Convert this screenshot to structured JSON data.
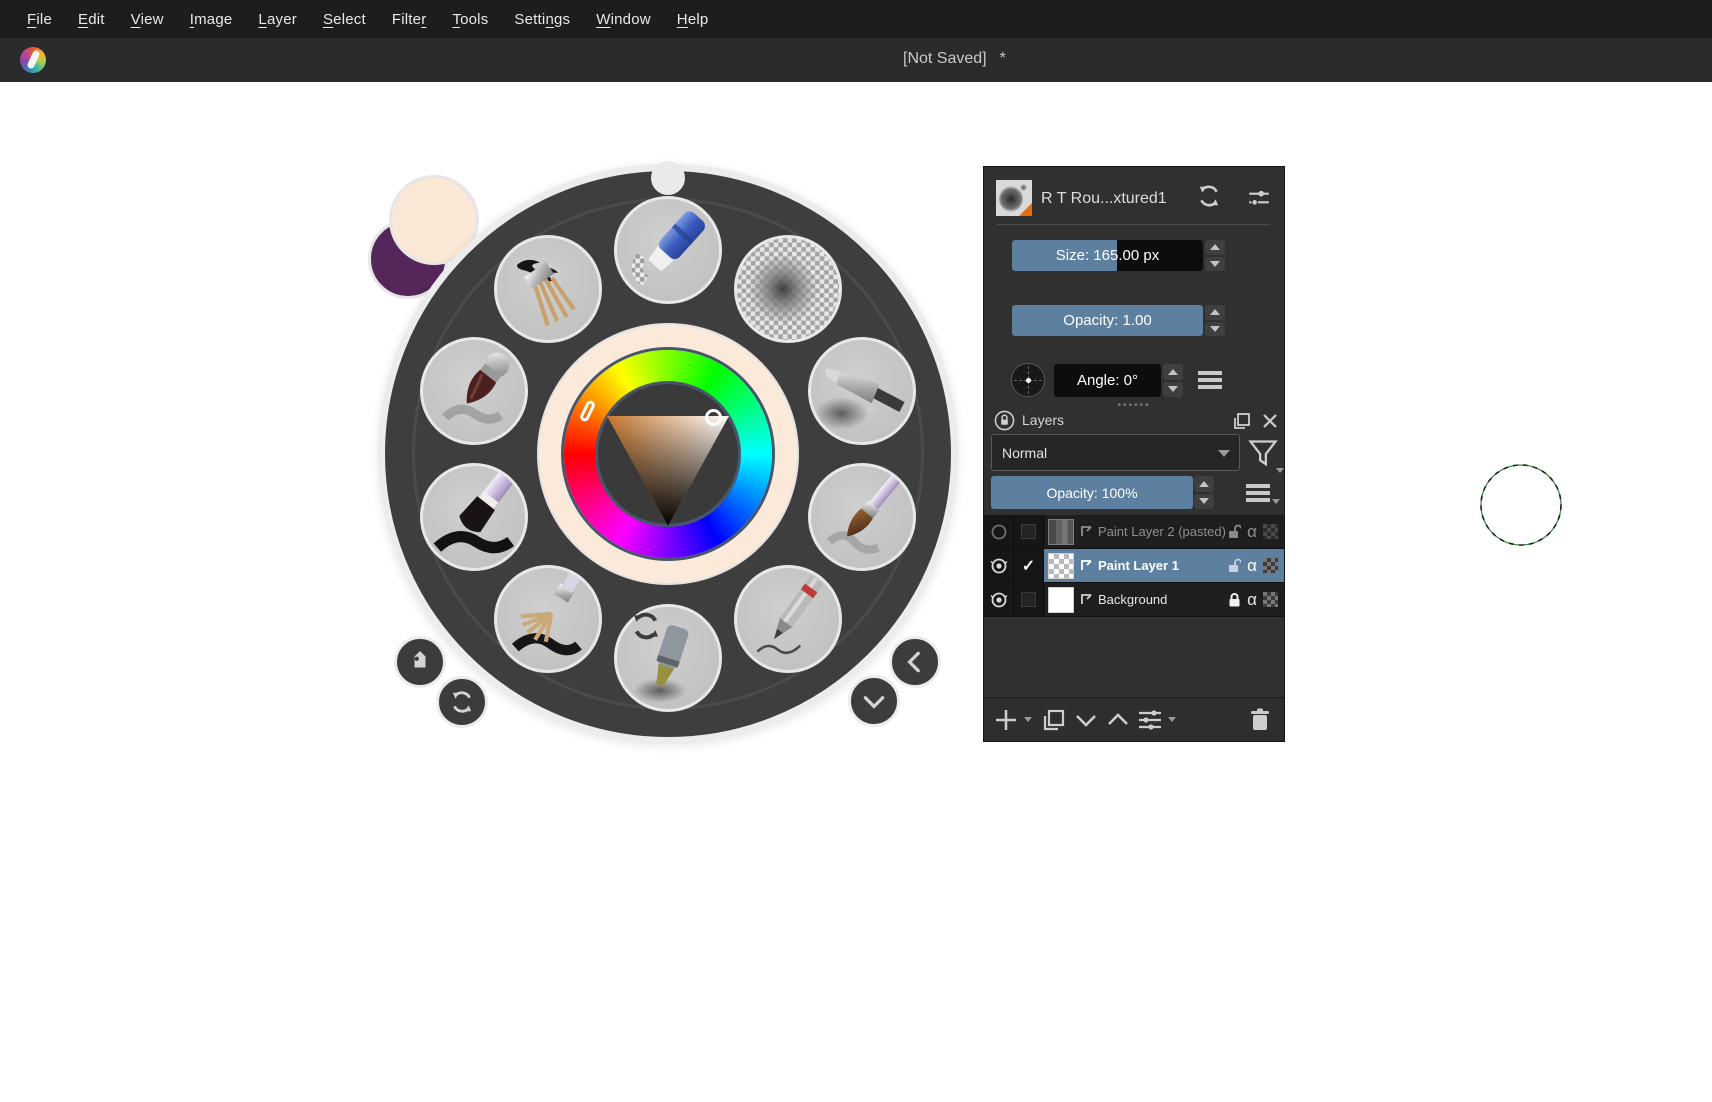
{
  "app": {
    "name": "Krita",
    "title_main": "[Not Saved]",
    "title_modified": "*"
  },
  "menu": {
    "items": [
      {
        "pre": "",
        "u": "F",
        "post": "ile"
      },
      {
        "pre": "",
        "u": "E",
        "post": "dit"
      },
      {
        "pre": "",
        "u": "V",
        "post": "iew"
      },
      {
        "pre": "",
        "u": "I",
        "post": "mage"
      },
      {
        "pre": "",
        "u": "L",
        "post": "ayer"
      },
      {
        "pre": "",
        "u": "S",
        "post": "elect"
      },
      {
        "pre": "Filte",
        "u": "r",
        "post": ""
      },
      {
        "pre": "",
        "u": "T",
        "post": "ools"
      },
      {
        "pre": "Setti",
        "u": "n",
        "post": "gs"
      },
      {
        "pre": "",
        "u": "W",
        "post": "indow"
      },
      {
        "pre": "",
        "u": "H",
        "post": "elp"
      }
    ]
  },
  "brush_editor": {
    "preset_name": "R T Rou...xtured1",
    "size_label": "Size: 165.00 px",
    "size_fill": 55,
    "opacity_label": "Opacity: 1.00",
    "opacity_fill": 100,
    "angle_label": "Angle: 0°",
    "icons": [
      "brush-preset-thumbnail",
      "reload-preset-icon",
      "detach-editor-icon",
      "angle-dial",
      "menu-icon"
    ]
  },
  "layers_panel": {
    "title": "Layers",
    "blend_mode": "Normal",
    "opacity_label": "Opacity:  100%",
    "opacity_fill": 100,
    "check_glyph": "✓",
    "alpha_glyph": "α",
    "rows": [
      {
        "name": "Paint Layer 2 (pasted)",
        "visible": false,
        "checked": false,
        "locked": false,
        "selected": false,
        "thumbnail": "grayscale-gradient"
      },
      {
        "name": "Paint Layer 1",
        "visible": true,
        "checked": true,
        "locked": false,
        "selected": true,
        "thumbnail": "transparent-checker"
      },
      {
        "name": "Background",
        "visible": true,
        "checked": false,
        "locked": true,
        "selected": false,
        "thumbnail": "white"
      }
    ],
    "toolbar_icons": [
      "add-layer-icon",
      "duplicate-layer-icon",
      "move-layer-down-icon",
      "move-layer-up-icon",
      "layer-properties-icon",
      "delete-layer-icon"
    ],
    "header_icons": [
      "panel-lock-icon",
      "float-panel-icon",
      "close-panel-icon",
      "filter-icon",
      "menu-icon"
    ]
  },
  "popup_palette": {
    "presets": [
      {
        "icon": "eraser-brush-icon",
        "position": "top"
      },
      {
        "icon": "soft-round-brush-icon",
        "position": "top-right"
      },
      {
        "icon": "airbrush-icon",
        "position": "right-upper"
      },
      {
        "icon": "round-watercolor-brush-icon",
        "position": "right-lower"
      },
      {
        "icon": "pencil-icon",
        "position": "bottom-right"
      },
      {
        "icon": "marker-brush-icon",
        "position": "bottom",
        "overlay": "reload-icon"
      },
      {
        "icon": "fan-brush-icon",
        "position": "bottom-left"
      },
      {
        "icon": "flat-brush-icon",
        "position": "left-lower"
      },
      {
        "icon": "pointed-brush-icon",
        "position": "left-upper"
      },
      {
        "icon": "bristle-ink-brush-icon",
        "position": "top-left"
      }
    ],
    "buttons": [
      "tag-icon",
      "reload-icon",
      "chevron-left-icon",
      "chevron-down-icon"
    ],
    "color_selector": {
      "selected_hue": "orange",
      "recent_color_swatch": "#fbe8d7",
      "previous_color_swatch": "#54265a",
      "triangle_hue_color": "#c8792f"
    }
  },
  "cursor": {
    "shape": "dashed-circle-brush-outline"
  },
  "colors": {
    "accent_blue": "#5d80a0",
    "menubar_bg": "#1d1d1d",
    "titlebar_bg": "#2b2b2b",
    "panel_bg": "#303030",
    "palette_ring": "#3e3e3e",
    "cream_ring": "#fbead9",
    "selection_row": "#5d80a0"
  }
}
